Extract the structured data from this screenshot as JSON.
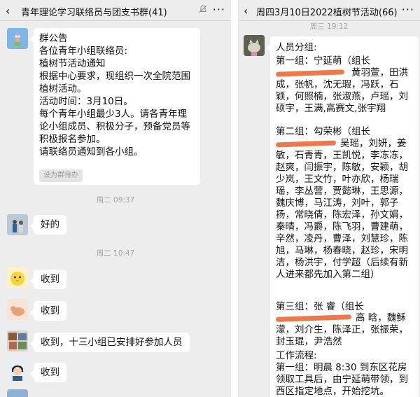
{
  "left_chat": {
    "title": "青年理论学习联络员与团支书群(41)",
    "announcement": "群公告\n各位青年小组联络员:\n植树节活动通知\n根据中心要求，现组织一次全院范围植树活动。\n活动时间：3月10日。\n每个青年小组最少3人。请各青年理论小组成员、积极分子，预备党员等积极报名参加。\n请联络员通知到各小组。",
    "set_todo_label": "设为群待办",
    "timestamp_1": "周二 09:37",
    "msg_1": "好的",
    "timestamp_2": "周二 10:47",
    "msg_2": "收到",
    "msg_3": "收到",
    "msg_4": "收到，十三小组已安排好参加人员",
    "msg_5": "收到"
  },
  "right_chat": {
    "title": "周四3月10日2022植树节活动(66)",
    "timestamp": "周三 19:12",
    "heading": "人员分组:",
    "g1_head": "第一组：宁延萌（组长",
    "g1_body": "黄羽萱，田洪成，张帆，沈无瑕，冯跃，石颖，何照楠，张淑燕，卢瑶，刘硕宇，王满,高赛文,张宇翔",
    "g2_head": "第二组：勾荣彬（组长",
    "g2_body": "吴瑶，刘妍，姜敏，石青青，王凯悦，李冻冻，赵爽，闫振宇，陈敏，安颖，胡少岚，王文竹，叶亦欣，杨瑞瑶，李丛营，贾懿琳，王思源，魏庆博，马江涛，刘叶，郭子扬，常晓倩，陈宏泽，孙文娟，秦晴，冯爵，陈飞羽，曹建萌，辛然，凌丹，曹泽，刘慧珍，陈旭，马琳，杨春晓，赵珍，宋明洁，杨洪宇，付学超（后续有新人进来都先加入第二组）",
    "g3_head": "第三组：张 睿（组长",
    "g3_body": "高 晗，魏稣濛，刘介生，陈泽正，张振荣，封玉琨，尹浩然",
    "flow_title": "工作流程:",
    "flow_body": "第一组：明晨 8:30 到东区花房领取工具后，由宁延萌带领，到西区指定地点，开始挖坑。"
  },
  "colors": {
    "chat_bg": "#ededed",
    "bubble_bg": "#ffffff",
    "scribble": "#e8622c",
    "timestamp": "#a3a3a3"
  }
}
